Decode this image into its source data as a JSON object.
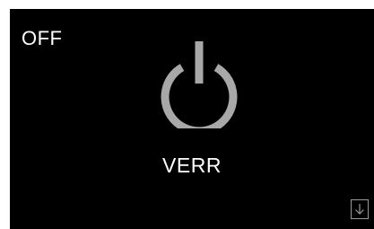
{
  "status": {
    "label": "OFF"
  },
  "power": {
    "icon": "power-icon",
    "color": "#a8a8a8"
  },
  "lock": {
    "label": "VERR"
  },
  "download": {
    "icon": "arrow-down-icon",
    "color": "#9a9a9a"
  },
  "colors": {
    "background": "#000000",
    "text": "#ffffff"
  }
}
